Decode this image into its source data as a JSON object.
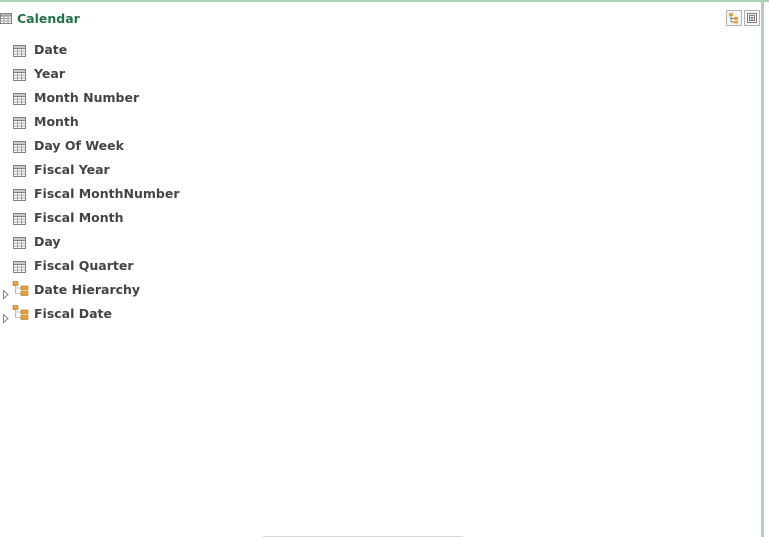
{
  "panel": {
    "title": "Calendar",
    "title_icon": "table-icon",
    "tools": [
      {
        "name": "hierarchy-view-icon"
      },
      {
        "name": "fit-view-icon"
      }
    ]
  },
  "fields": [
    {
      "label": "Date",
      "icon": "table-column-icon",
      "type": "column"
    },
    {
      "label": "Year",
      "icon": "table-column-icon",
      "type": "column"
    },
    {
      "label": "Month Number",
      "icon": "table-column-icon",
      "type": "column"
    },
    {
      "label": "Month",
      "icon": "table-column-icon",
      "type": "column"
    },
    {
      "label": "Day Of Week",
      "icon": "table-column-icon",
      "type": "column"
    },
    {
      "label": "Fiscal Year",
      "icon": "table-column-icon",
      "type": "column"
    },
    {
      "label": "Fiscal MonthNumber",
      "icon": "table-column-icon",
      "type": "column"
    },
    {
      "label": "Fiscal Month",
      "icon": "table-column-icon",
      "type": "column"
    },
    {
      "label": "Day",
      "icon": "table-column-icon",
      "type": "column"
    },
    {
      "label": "Fiscal Quarter",
      "icon": "table-column-icon",
      "type": "column"
    },
    {
      "label": "Date Hierarchy",
      "icon": "hierarchy-icon",
      "type": "hierarchy"
    },
    {
      "label": "Fiscal Date",
      "icon": "hierarchy-icon",
      "type": "hierarchy"
    }
  ],
  "colors": {
    "title": "#217346",
    "field_text": "#444444",
    "border": "#a9d4b5"
  }
}
